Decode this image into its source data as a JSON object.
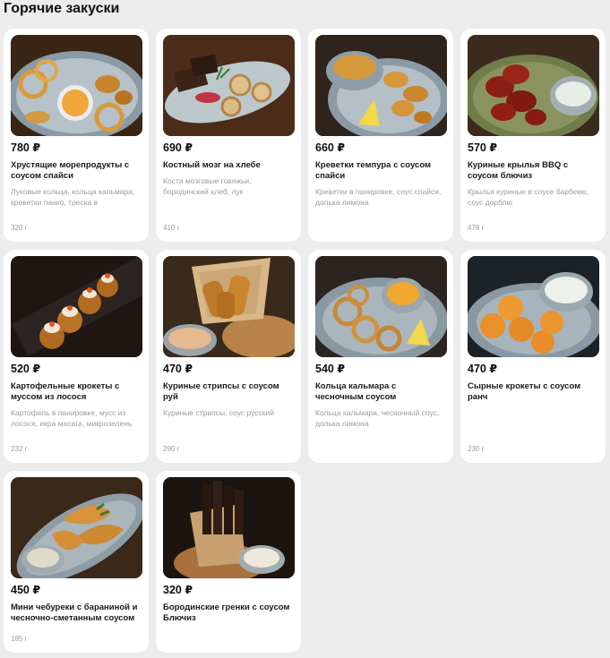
{
  "section": {
    "title": "Горячие закуски"
  },
  "items": [
    {
      "price": "780 ₽",
      "name": "Хрустящие морепродукты с соусом спайси",
      "desc": "Луковые кольца, кольца кальмара, креветки панко, треска в",
      "weight": "320 г",
      "icon": "seafood-platter-icon"
    },
    {
      "price": "690 ₽",
      "name": "Костный мозг на хлебе",
      "desc": "Кости мозговые говяжьи, бородинский хлеб, лук",
      "weight": "410 г",
      "icon": "bone-marrow-icon"
    },
    {
      "price": "660 ₽",
      "name": "Креветки темпура с соусом спайси",
      "desc": "Креветки в панировке, соус спайси, долька лимона",
      "weight": "",
      "icon": "tempura-shrimp-icon"
    },
    {
      "price": "570 ₽",
      "name": "Куриные крылья BBQ с соусом блючиз",
      "desc": "Крылья куриные в соусе барбекю, соус дорблю",
      "weight": "478 г",
      "icon": "chicken-wings-icon"
    },
    {
      "price": "520 ₽",
      "name": "Картофельные крокеты с муссом из лосося",
      "desc": "Картофель в панировке, мусс из лосося, икра масага, микрозелень",
      "weight": "232 г",
      "icon": "potato-croquettes-icon"
    },
    {
      "price": "470 ₽",
      "name": "Куриные стрипсы с соусом руй",
      "desc": "Куриные стрипсы, соус русский",
      "weight": "290 г",
      "icon": "chicken-strips-icon"
    },
    {
      "price": "540 ₽",
      "name": "Кольца кальмара с чесночным соусом",
      "desc": "Кольца кальмара, чесночный соус, долька лимона",
      "weight": "",
      "icon": "squid-rings-icon"
    },
    {
      "price": "470 ₽",
      "name": "Сырные крокеты с соусом ранч",
      "desc": "",
      "weight": "230 г",
      "icon": "cheese-croquettes-icon"
    },
    {
      "price": "450 ₽",
      "name": "Мини чебуреки с бараниной и чесночно-сметанным соусом",
      "desc": "",
      "weight": "185 г",
      "icon": "chebureki-icon"
    },
    {
      "price": "320 ₽",
      "name": "Бородинские гренки с соусом Блючиз",
      "desc": "",
      "weight": "",
      "icon": "rye-croutons-icon"
    }
  ]
}
